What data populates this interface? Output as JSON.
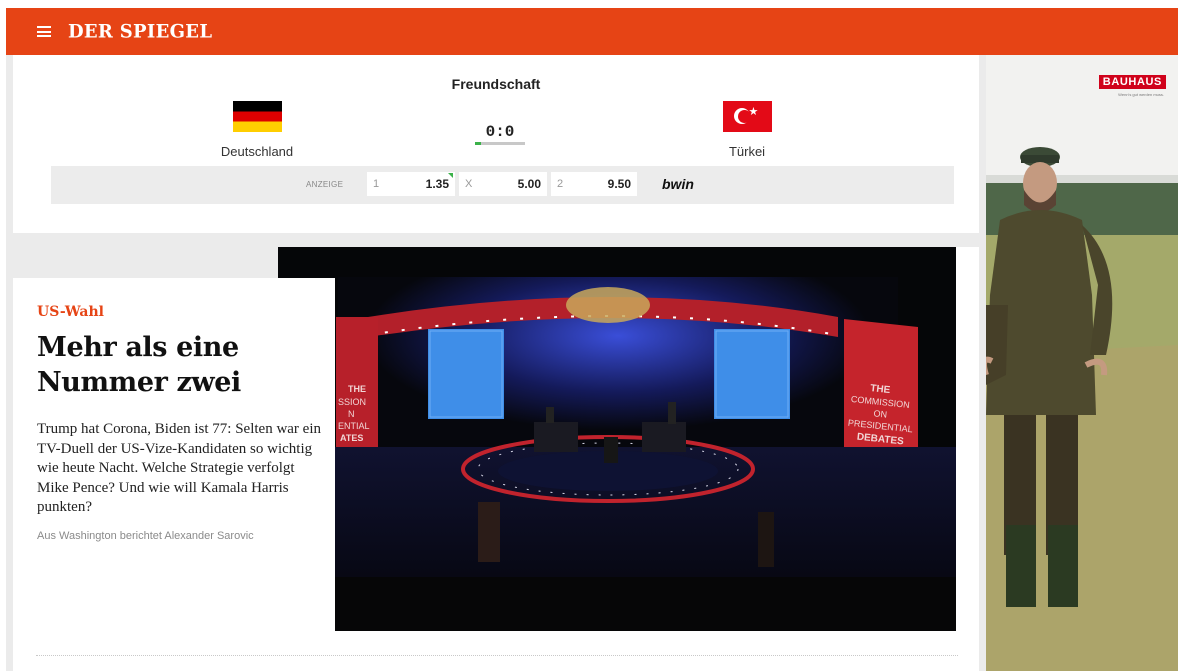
{
  "header": {
    "logo": "DER SPIEGEL"
  },
  "match": {
    "competition": "Freundschaft",
    "home": {
      "name": "Deutschland",
      "flag": "flag-de"
    },
    "away": {
      "name": "Türkei",
      "flag": "flag-tr"
    },
    "score": "0:0",
    "odds": {
      "label": "ANZEIGE",
      "home_key": "1",
      "home_value": "1.35",
      "draw_key": "X",
      "draw_value": "5.00",
      "away_key": "2",
      "away_value": "9.50",
      "bookmaker": "bwin"
    }
  },
  "article": {
    "kicker": "US-Wahl",
    "headline": "Mehr als eine Nummer zwei",
    "teaser": "Trump hat Corona, Biden ist 77: Selten war ein TV-Duell der US-Vize-Kandidaten so wichtig wie heute Nacht. Welche Strategie verfolgt Mike Pence? Und wie will Kamala Harris punkten?",
    "byline": "Aus Washington berichtet Alexander Sarovic",
    "image": {
      "left_banner": "THE COMMISSION ON PRESIDENTIAL DEBATES",
      "right_banner": "THE COMMISSION ON PRESIDENTIAL DEBATES"
    }
  },
  "ad": {
    "brand": "BAUHAUS",
    "tagline": "Wenn's gut werden muss."
  },
  "colors": {
    "brand": "#e64415",
    "live_green": "#3bb24a",
    "ad_red": "#d0021b"
  }
}
